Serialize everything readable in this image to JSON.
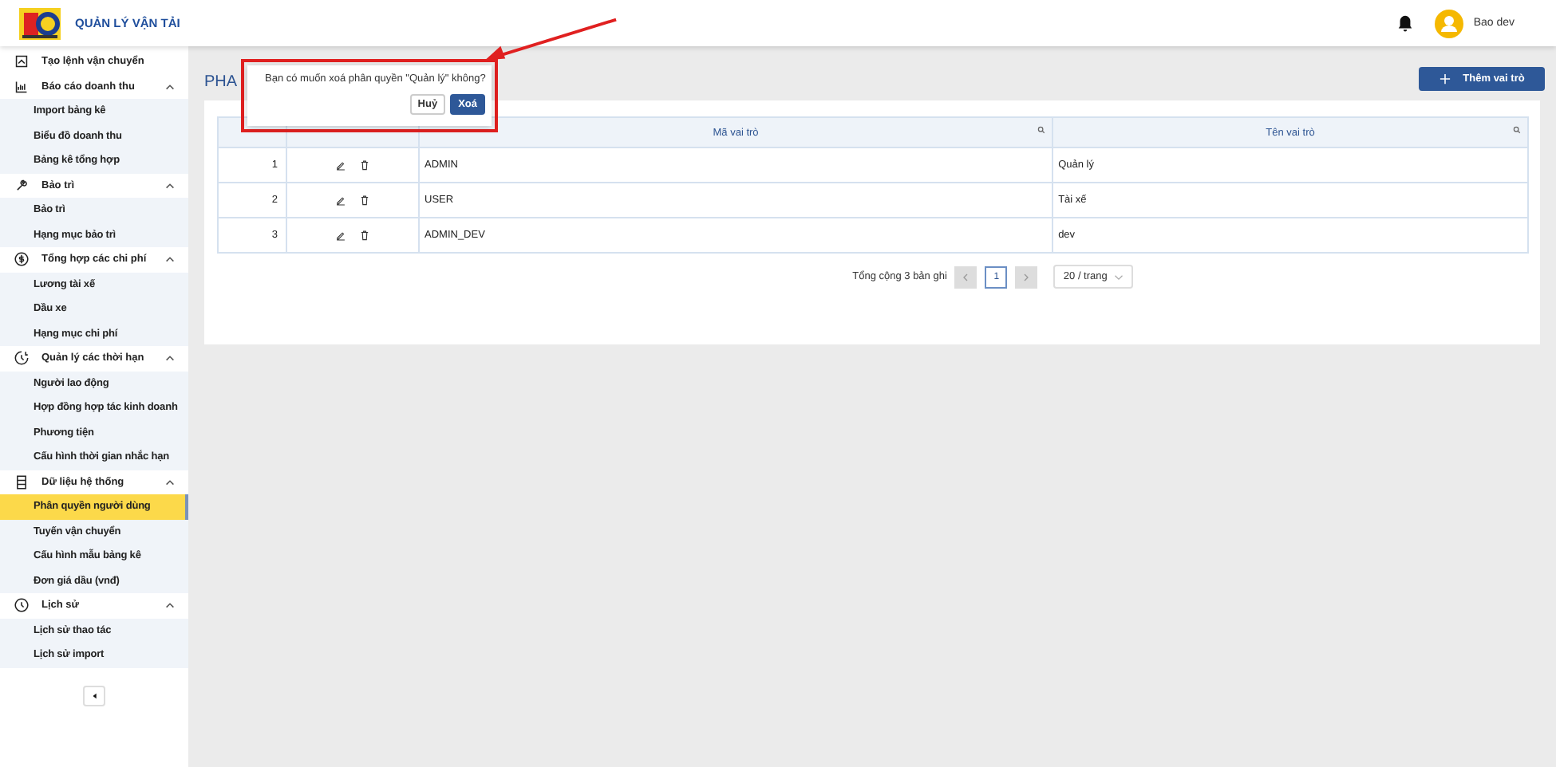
{
  "header": {
    "app_title": "QUẢN LÝ VẬN TẢI",
    "user_name": "Bao dev"
  },
  "sidebar": {
    "items": [
      {
        "label": "Tạo lệnh vận chuyển"
      },
      {
        "label": "Báo cáo doanh thu",
        "expanded": true,
        "children": [
          {
            "label": "Import bảng kê",
            "selected": false
          },
          {
            "label": "Biểu đồ doanh thu",
            "selected": false
          },
          {
            "label": "Bảng kê tổng hợp",
            "selected": false
          }
        ]
      },
      {
        "label": "Bảo trì",
        "expanded": true,
        "children": [
          {
            "label": "Bảo trì",
            "selected": false
          },
          {
            "label": "Hạng mục bảo trì",
            "selected": false
          }
        ]
      },
      {
        "label": "Tổng hợp các chi phí",
        "expanded": true,
        "children": [
          {
            "label": "Lương tài xế",
            "selected": false
          },
          {
            "label": "Dầu xe",
            "selected": false
          },
          {
            "label": "Hạng mục chi phí",
            "selected": false
          }
        ]
      },
      {
        "label": "Quản lý các thời hạn",
        "expanded": true,
        "children": [
          {
            "label": "Người lao động",
            "selected": false
          },
          {
            "label": "Hợp đồng hợp tác kinh doanh",
            "selected": false
          },
          {
            "label": "Phương tiện",
            "selected": false
          },
          {
            "label": "Cấu hình thời gian nhắc hạn",
            "selected": false
          }
        ]
      },
      {
        "label": "Dữ liệu hệ thống",
        "expanded": true,
        "children": [
          {
            "label": "Phân quyền người dùng",
            "selected": true
          },
          {
            "label": "Tuyến vận chuyển",
            "selected": false
          },
          {
            "label": "Cấu hình mẫu bảng kê",
            "selected": false
          },
          {
            "label": "Đơn giá dầu (vnđ)",
            "selected": false
          }
        ]
      },
      {
        "label": "Lịch sử",
        "expanded": true,
        "children": [
          {
            "label": "Lịch sử thao tác",
            "selected": false
          },
          {
            "label": "Lịch sử import",
            "selected": false
          }
        ]
      }
    ]
  },
  "page": {
    "title": "PHA",
    "add_button": "Thêm vai trò"
  },
  "table": {
    "columns": [
      "Mã vai trò",
      "Tên vai trò"
    ],
    "rows": [
      {
        "index": "1",
        "code": "ADMIN",
        "name": "Quản lý"
      },
      {
        "index": "2",
        "code": "USER",
        "name": "Tài xế"
      },
      {
        "index": "3",
        "code": "ADMIN_DEV",
        "name": "dev"
      }
    ]
  },
  "pagination": {
    "total": "Tổng cộng 3 bản ghi",
    "prev_disabled": true,
    "pages": [
      {
        "label": "1",
        "selected": true
      }
    ],
    "next_disabled": true,
    "page_size": "20 / trang"
  },
  "popconfirm": {
    "message": "Bạn có muốn xoá phân quyền \"Quản lý\" không?",
    "cancel": "Huỷ",
    "confirm": "Xoá"
  }
}
